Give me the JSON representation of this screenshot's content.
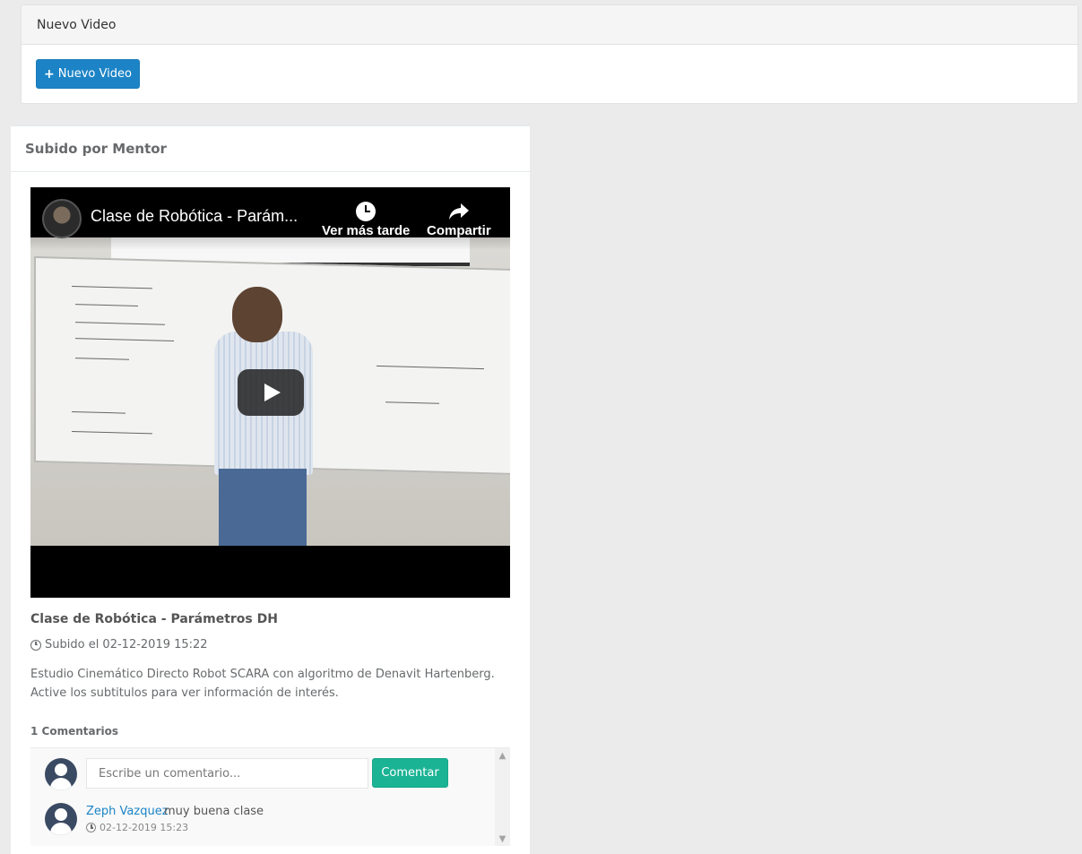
{
  "new_video_panel": {
    "title": "Nuevo Video",
    "button_label": "Nuevo Video",
    "button_icon": "+"
  },
  "card": {
    "header": "Subido por Mentor",
    "player": {
      "title": "Clase de Robótica - Parám...",
      "watch_later": "Ver más tarde",
      "share": "Compartir"
    },
    "video_title": "Clase de Robótica - Parámetros DH",
    "uploaded": "Subido el 02-12-2019 15:22",
    "description": "Estudio Cinemático Directo Robot SCARA con algoritmo de Denavit Hartenberg. Active los subtitulos para ver información de interés.",
    "comments_count": "1 Comentarios",
    "comment_form": {
      "placeholder": "Escribe un comentario...",
      "submit_label": "Comentar"
    },
    "comments": [
      {
        "author": "Zeph Vazquez",
        "text": "muy buena clase",
        "date": "02-12-2019 15:23"
      }
    ]
  },
  "colors": {
    "primary": "#1c84c6",
    "success": "#1ab394",
    "background": "#ebebeb"
  }
}
